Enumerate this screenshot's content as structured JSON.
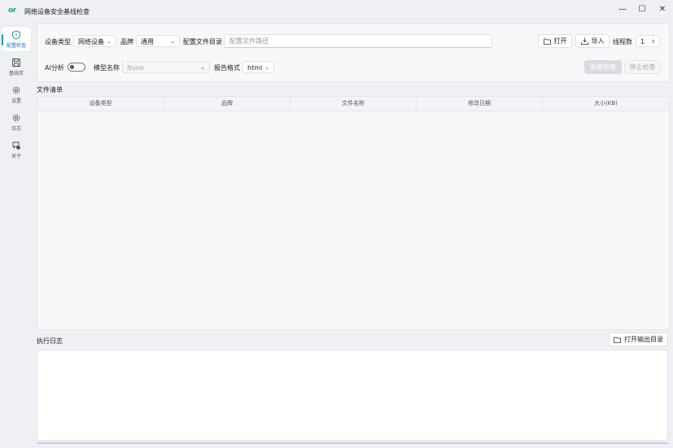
{
  "window": {
    "logo_text": "or",
    "title": "网络设备安全基线检查",
    "minimize": "—",
    "maximize": "☐",
    "close": "✕"
  },
  "sidebar": {
    "items": [
      {
        "label": "配置检查",
        "icon": "shield-icon",
        "active": true
      },
      {
        "label": "基线库",
        "icon": "save-icon",
        "active": false
      },
      {
        "label": "设置",
        "icon": "gear-icon",
        "active": false
      },
      {
        "label": "日志",
        "icon": "gear-icon",
        "active": false
      },
      {
        "label": "关于",
        "icon": "chat-info-icon",
        "active": false
      }
    ]
  },
  "toolbar": {
    "device_type_label": "设备类型",
    "device_type_value": "网络设备",
    "brand_label": "品牌",
    "brand_value": "通用",
    "config_dir_label": "配置文件目录",
    "config_path_placeholder": "配置文件路径",
    "open_button": "打开",
    "import_button": "导入",
    "threads_label": "线程数",
    "threads_value": "1",
    "ai_label": "AI分析",
    "model_label": "模型名称",
    "model_value": "None",
    "report_format_label": "报告格式",
    "report_format_value": "html",
    "batch_check_button": "批量检查",
    "stop_check_button": "停止检查"
  },
  "file_list": {
    "title": "文件清单",
    "columns": [
      "设备类型",
      "品牌",
      "文件名称",
      "修改日期",
      "大小(KB)"
    ]
  },
  "log": {
    "title": "执行日志",
    "open_output_button": "打开输出目录"
  },
  "colors": {
    "accent": "#1aa39a",
    "background": "#eef0f4",
    "panel": "#f7f8fa"
  }
}
